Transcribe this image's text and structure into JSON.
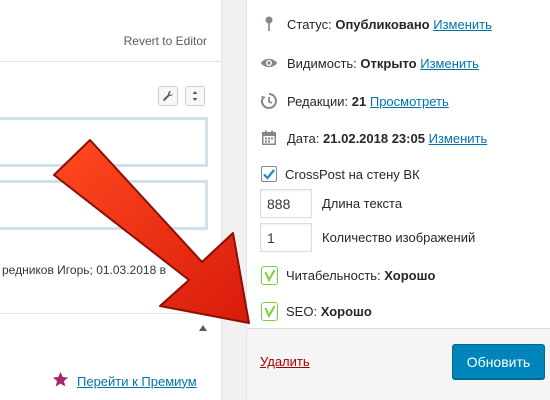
{
  "editor": {
    "revert_label": "Revert to Editor",
    "meta_line": "редников Игорь; 01.03.2018 в",
    "premium_label": "Перейти к Премиум"
  },
  "publish": {
    "status": {
      "label": "Статус:",
      "value": "Опубликовано",
      "link": "Изменить",
      "icon": "pin-icon"
    },
    "visibility": {
      "label": "Видимость:",
      "value": "Открыто",
      "link": "Изменить",
      "icon": "eye-icon"
    },
    "revisions": {
      "label": "Редакции:",
      "value": "21",
      "link": "Просмотреть",
      "icon": "history-icon"
    },
    "date": {
      "label": "Дата:",
      "value": "21.02.2018 23:05",
      "link": "Изменить",
      "icon": "calendar-icon"
    },
    "crosspost": {
      "label": "CrossPost на стену ВК",
      "checked": true
    },
    "text_length": {
      "value": "888",
      "label": "Длина текста"
    },
    "image_count": {
      "value": "1",
      "label": "Количество изображений"
    },
    "readability": {
      "label": "Читабельность:",
      "value": "Хорошо"
    },
    "seo": {
      "label": "SEO:",
      "value": "Хорошо"
    },
    "delete_label": "Удалить",
    "update_label": "Обновить"
  },
  "colors": {
    "link": "#0073aa",
    "primary_button": "#0085ba",
    "delete": "#aa0000",
    "yoast_good": "#7ad03a",
    "arrow": "#e8260f"
  }
}
